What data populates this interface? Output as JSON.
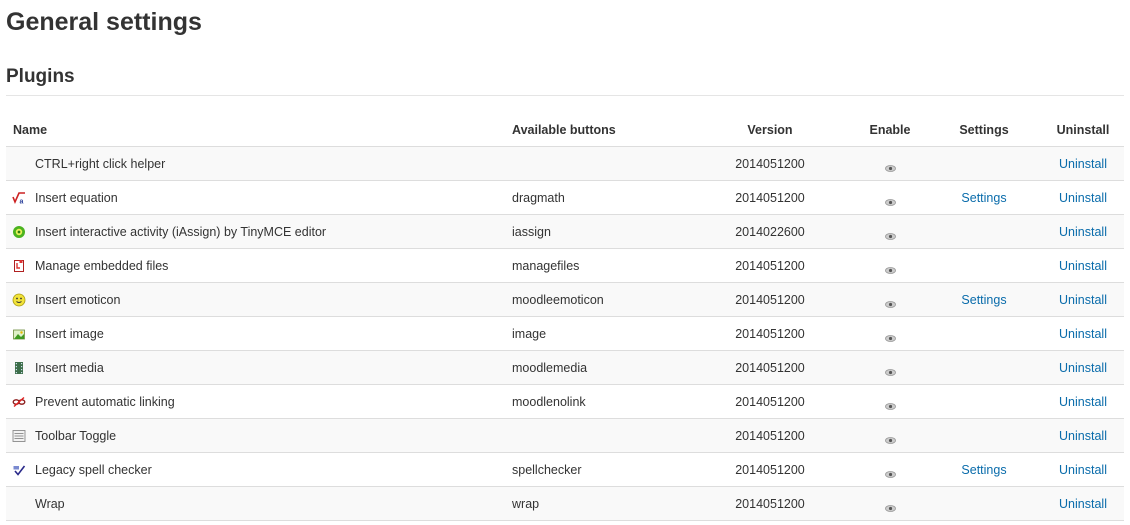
{
  "page_title": "General settings",
  "section_title": "Plugins",
  "columns": {
    "name": "Name",
    "buttons": "Available buttons",
    "version": "Version",
    "enable": "Enable",
    "settings": "Settings",
    "uninstall": "Uninstall"
  },
  "rows": [
    {
      "name": "CTRL+right click helper",
      "buttons": "",
      "version": "2014051200",
      "settings": "",
      "uninstall": "Uninstall",
      "icon": "none"
    },
    {
      "name": "Insert equation",
      "buttons": "dragmath",
      "version": "2014051200",
      "settings": "Settings",
      "uninstall": "Uninstall",
      "icon": "equation-icon"
    },
    {
      "name": "Insert interactive activity (iAssign) by TinyMCE editor",
      "buttons": "iassign",
      "version": "2014022600",
      "settings": "",
      "uninstall": "Uninstall",
      "icon": "iassign-gear-icon"
    },
    {
      "name": "Manage embedded files",
      "buttons": "managefiles",
      "version": "2014051200",
      "settings": "",
      "uninstall": "Uninstall",
      "icon": "manage-files-icon"
    },
    {
      "name": "Insert emoticon",
      "buttons": "moodleemoticon",
      "version": "2014051200",
      "settings": "Settings",
      "uninstall": "Uninstall",
      "icon": "emoticon-icon"
    },
    {
      "name": "Insert image",
      "buttons": "image",
      "version": "2014051200",
      "settings": "",
      "uninstall": "Uninstall",
      "icon": "image-icon"
    },
    {
      "name": "Insert media",
      "buttons": "moodlemedia",
      "version": "2014051200",
      "settings": "",
      "uninstall": "Uninstall",
      "icon": "media-film-icon"
    },
    {
      "name": "Prevent automatic linking",
      "buttons": "moodlenolink",
      "version": "2014051200",
      "settings": "",
      "uninstall": "Uninstall",
      "icon": "nolink-icon"
    },
    {
      "name": "Toolbar Toggle",
      "buttons": "",
      "version": "2014051200",
      "settings": "",
      "uninstall": "Uninstall",
      "icon": "toolbar-toggle-icon"
    },
    {
      "name": "Legacy spell checker",
      "buttons": "spellchecker",
      "version": "2014051200",
      "settings": "Settings",
      "uninstall": "Uninstall",
      "icon": "spellcheck-icon"
    },
    {
      "name": "Wrap",
      "buttons": "wrap",
      "version": "2014051200",
      "settings": "",
      "uninstall": "Uninstall",
      "icon": "none"
    }
  ],
  "colors": {
    "link": "#0a6cab",
    "stripe": "#f9f9f9",
    "border": "#dddddd",
    "text": "#333333"
  }
}
